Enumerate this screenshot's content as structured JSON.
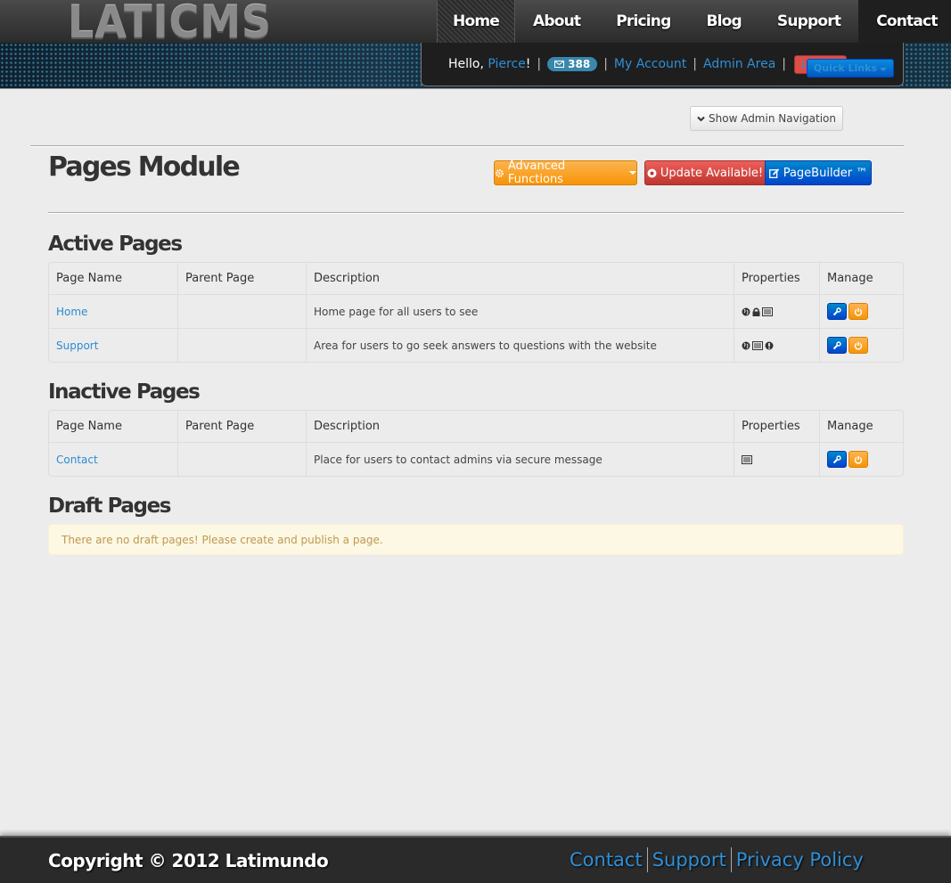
{
  "header": {
    "logo_text": "LATICMS",
    "nav": [
      {
        "label": "Home"
      },
      {
        "label": "About"
      },
      {
        "label": "Pricing"
      },
      {
        "label": "Blog"
      },
      {
        "label": "Support"
      },
      {
        "label": "Contact"
      }
    ],
    "user": {
      "greeting": "Hello, ",
      "username": "Pierce",
      "exclamation": "!",
      "message_count": "388",
      "my_account": "My Account",
      "admin_area": "Admin Area",
      "logout": "Log Out",
      "quick_links": "Quick Links"
    }
  },
  "admin_nav_button": "Show Admin Navigation",
  "page_title": "Pages Module",
  "actions": {
    "advanced": "Advanced Functions",
    "update": "Update Available!",
    "pagebuilder": "PageBuilder ™"
  },
  "columns": [
    "Page Name",
    "Parent Page",
    "Description",
    "Properties",
    "Manage"
  ],
  "sections": {
    "active": {
      "title": "Active Pages",
      "rows": [
        {
          "name": "Home",
          "parent": "",
          "description": "Home page for all users to see",
          "properties": [
            "globe-icon",
            "lock-icon",
            "list-icon"
          ]
        },
        {
          "name": "Support",
          "parent": "",
          "description": "Area for users to go seek answers to questions with the website",
          "properties": [
            "globe-icon",
            "list-icon",
            "exclamation-icon"
          ]
        }
      ]
    },
    "inactive": {
      "title": "Inactive Pages",
      "rows": [
        {
          "name": "Contact",
          "parent": "",
          "description": "Place for users to contact admins via secure message",
          "properties": [
            "list-icon"
          ]
        }
      ]
    },
    "draft": {
      "title": "Draft Pages",
      "empty_message": "There are no draft pages! Please create and publish a page."
    }
  },
  "footer": {
    "copyright": "Copyright © 2012 Latimundo",
    "links": [
      "Contact",
      "Support",
      "Privacy Policy"
    ]
  },
  "colors": {
    "link": "#2a8bd3",
    "orange": "#f89406",
    "red": "#bd362f",
    "blue": "#0044cc"
  }
}
